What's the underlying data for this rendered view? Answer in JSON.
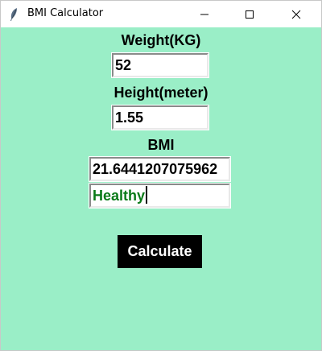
{
  "window": {
    "title": "BMI Calculator",
    "icon": "feather-icon",
    "background": "#9aeec7"
  },
  "form": {
    "weight_label": "Weight(KG)",
    "weight_value": "52",
    "height_label": "Height(meter)",
    "height_value": "1.55",
    "bmi_label": "BMI",
    "bmi_value": "21.6441207075962",
    "status_value": "Healthy",
    "status_color": "#0a7a18"
  },
  "actions": {
    "calculate_label": "Calculate"
  }
}
